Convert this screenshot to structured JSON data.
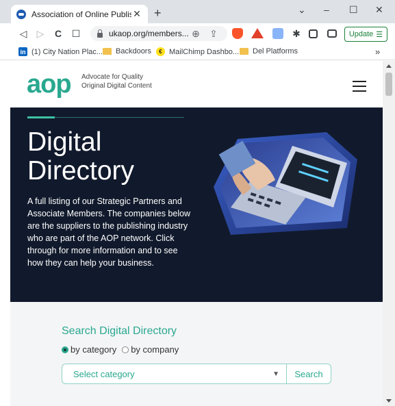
{
  "browser": {
    "tab": {
      "title": "Association of Online Publishers",
      "favicon": "aop-favicon",
      "close": "✕"
    },
    "new_tab": "+",
    "window_controls": {
      "minimize": "–",
      "maximize": "☐",
      "close": "✕",
      "tab_search": "⌄"
    },
    "nav": {
      "back": "◁",
      "forward": "▷",
      "reload": "C",
      "bookmark": "☐"
    },
    "url": "ukaop.org/members...",
    "omnibox_icons": {
      "zoom": "⊕",
      "share": "⇪"
    },
    "update_label": "Update",
    "update_menu": "☰"
  },
  "bookmarks": [
    {
      "label": "(1) City Nation Plac...",
      "icon": "linkedin-icon"
    },
    {
      "label": "Backdoors",
      "icon": "folder-icon"
    },
    {
      "label": "MailChimp Dashbo...",
      "icon": "mailchimp-icon"
    },
    {
      "label": "Del Platforms",
      "icon": "folder-icon"
    }
  ],
  "bookmarks_more": "»",
  "site": {
    "logo_text": "aop",
    "tagline_line1": "Advocate for Quality",
    "tagline_line2": "Original Digital Content",
    "hero": {
      "title_line1": "Digital",
      "title_line2": "Directory",
      "description": "A full listing of our Strategic Partners and Associate Members. The companies below are the suppliers to the publishing industry who are part of the AOP network. Click through for more information and to see how they can help your business."
    },
    "search": {
      "title": "Search Digital Directory",
      "option_category": "by category",
      "option_company": "by company",
      "selected_option": "by category",
      "select_placeholder": "Select category",
      "button_label": "Search"
    }
  },
  "colors": {
    "accent": "#29a88f",
    "hero_bg": "#111a2c",
    "search_bg": "#f4f5f7"
  }
}
